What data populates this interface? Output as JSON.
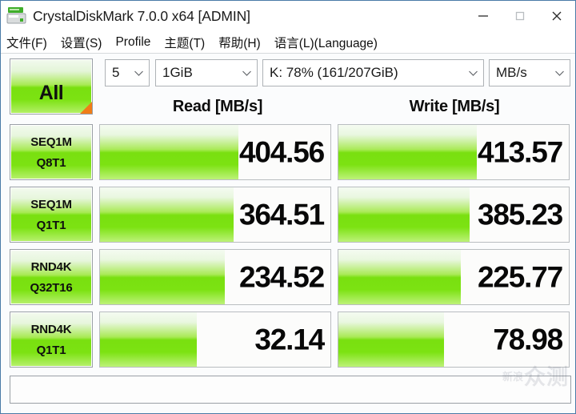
{
  "window": {
    "title": "CrystalDiskMark 7.0.0 x64 [ADMIN]",
    "app_icon": "disk-drive-icon",
    "controls": {
      "minimize": "minimize-icon",
      "maximize": "maximize-icon",
      "close": "close-icon"
    }
  },
  "menubar": {
    "items": [
      {
        "label": "文件(F)"
      },
      {
        "label": "设置(S)"
      },
      {
        "label": "Profile"
      },
      {
        "label": "主题(T)"
      },
      {
        "label": "帮助(H)"
      },
      {
        "label": "语言(L)(Language)"
      }
    ]
  },
  "toolbar": {
    "all_button": "All",
    "test_count": "5",
    "test_size": "1GiB",
    "drive": "K: 78% (161/207GiB)",
    "unit": "MB/s"
  },
  "headers": {
    "read": "Read [MB/s]",
    "write": "Write [MB/s]"
  },
  "chart_data": {
    "type": "bar",
    "title": "CrystalDiskMark 7.0.0 benchmark results",
    "xlabel": "",
    "ylabel": "MB/s",
    "categories": [
      "SEQ1M Q8T1",
      "SEQ1M Q1T1",
      "RND4K Q32T16",
      "RND4K Q1T1"
    ],
    "series": [
      {
        "name": "Read [MB/s]",
        "values": [
          404.56,
          364.51,
          234.52,
          32.14
        ]
      },
      {
        "name": "Write [MB/s]",
        "values": [
          413.57,
          385.23,
          225.77,
          78.98
        ]
      }
    ],
    "bar_fill_percent": {
      "read": [
        60,
        58,
        54,
        42
      ],
      "write": [
        60,
        57,
        53,
        46
      ]
    },
    "grid": false,
    "legend": "top"
  },
  "rows": [
    {
      "label_line1": "SEQ1M",
      "label_line2": "Q8T1",
      "read_value": "404.56",
      "write_value": "413.57",
      "read_fill": "60%",
      "write_fill": "60%"
    },
    {
      "label_line1": "SEQ1M",
      "label_line2": "Q1T1",
      "read_value": "364.51",
      "write_value": "385.23",
      "read_fill": "58%",
      "write_fill": "57%"
    },
    {
      "label_line1": "RND4K",
      "label_line2": "Q32T16",
      "read_value": "234.52",
      "write_value": "225.77",
      "read_fill": "54%",
      "write_fill": "53%"
    },
    {
      "label_line1": "RND4K",
      "label_line2": "Q1T1",
      "read_value": "32.14",
      "write_value": "78.98",
      "read_fill": "42%",
      "write_fill": "46%"
    }
  ],
  "comment_box": {
    "value": ""
  },
  "watermark": {
    "prefix": "新浪",
    "text": "众测"
  },
  "colors": {
    "bar_green_bright": "#79e010",
    "bar_green_light": "#b9f170",
    "accent_orange": "#f07c18",
    "window_border": "#4a7ba7"
  }
}
